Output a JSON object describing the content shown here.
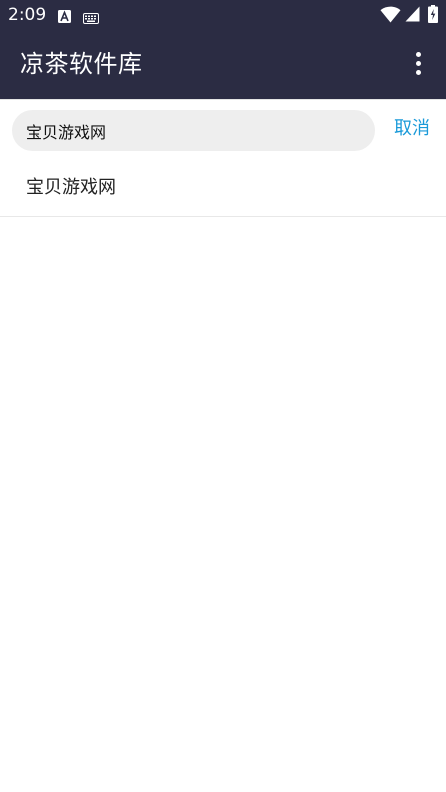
{
  "status_bar": {
    "time": "2:09",
    "icons": [
      "font-notification-icon",
      "keyboard-notification-icon",
      "wifi-icon",
      "cell-signal-icon",
      "battery-charging-icon"
    ]
  },
  "app_bar": {
    "title": "凉茶软件库",
    "menu_icon": "more-vert-icon",
    "background_color": "#2b2c43"
  },
  "search": {
    "value": "宝贝游戏网",
    "cancel_label": "取消",
    "accent_color": "#1a9ad9"
  },
  "suggestions": [
    {
      "label": "宝贝游戏网"
    }
  ]
}
